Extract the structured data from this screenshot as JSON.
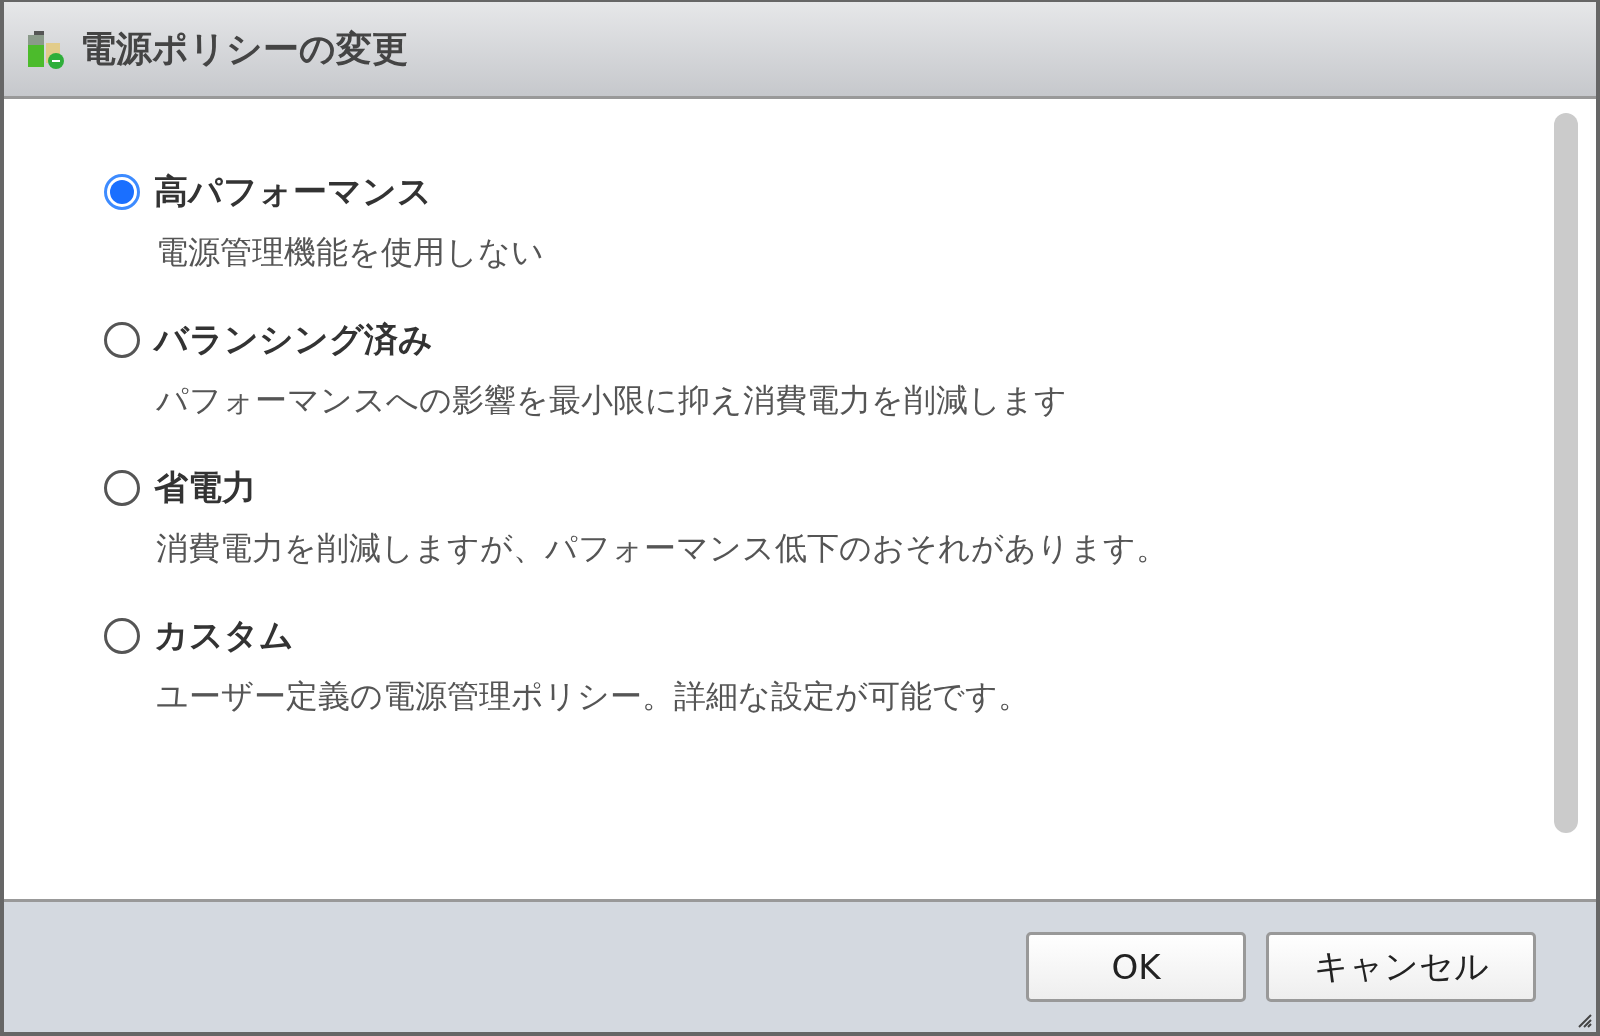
{
  "window": {
    "title": "電源ポリシーの変更"
  },
  "options": [
    {
      "label": "高パフォーマンス",
      "description": "電源管理機能を使用しない",
      "selected": true
    },
    {
      "label": "バランシング済み",
      "description": "パフォーマンスへの影響を最小限に抑え消費電力を削減します",
      "selected": false
    },
    {
      "label": "省電力",
      "description": "消費電力を削減しますが、パフォーマンス低下のおそれがあります。",
      "selected": false
    },
    {
      "label": "カスタム",
      "description": "ユーザー定義の電源管理ポリシー。詳細な設定が可能です。",
      "selected": false
    }
  ],
  "buttons": [
    "OK",
    "キャンセル"
  ]
}
